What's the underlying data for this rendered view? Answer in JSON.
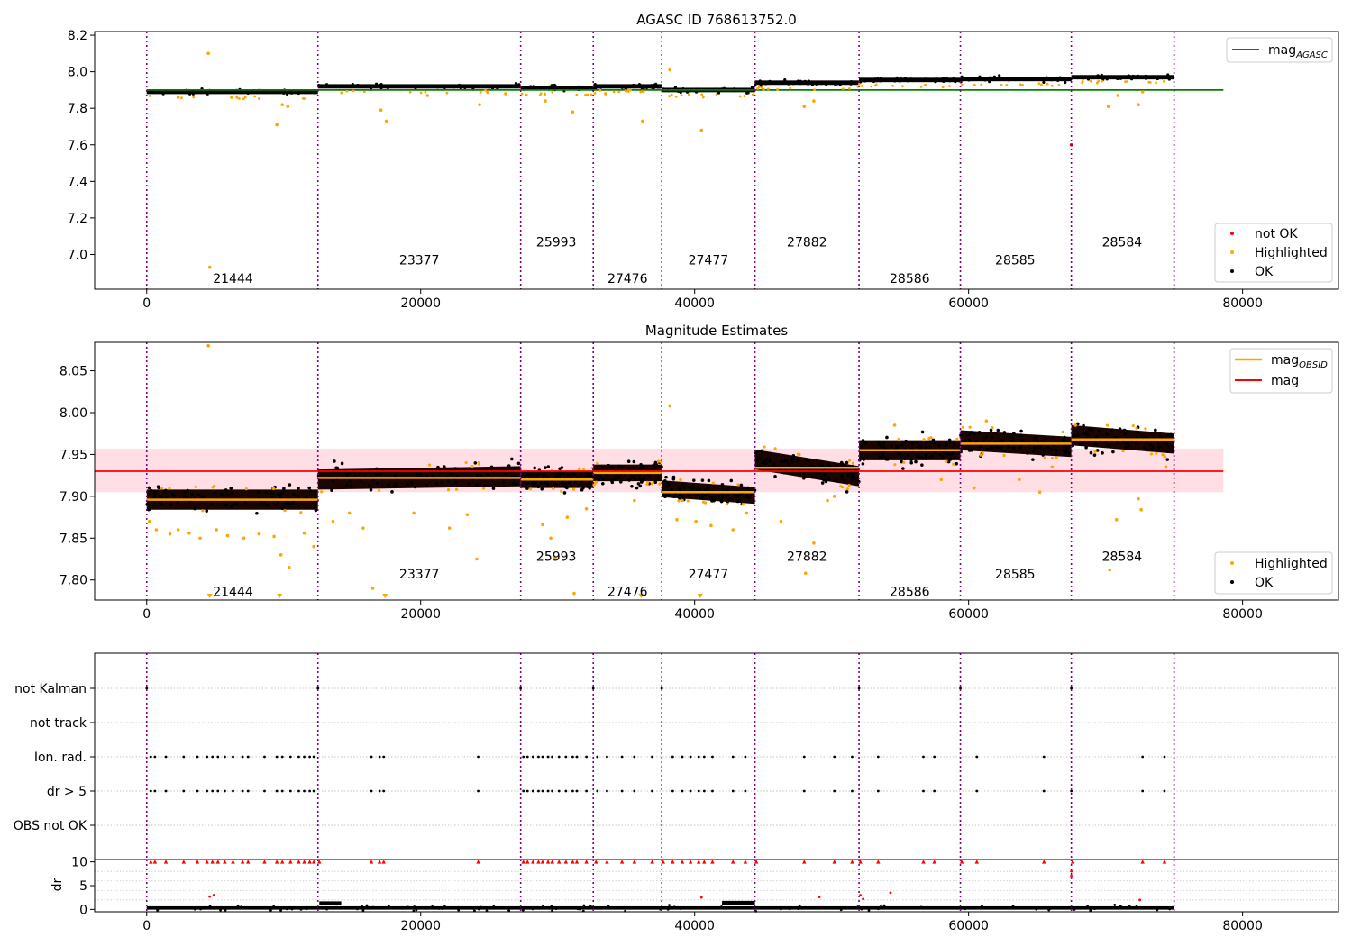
{
  "chart_data": [
    {
      "type": "scatter",
      "title": "AGASC ID 768613752.0",
      "xlabel": "",
      "ylabel": "",
      "xlim": [
        -3800,
        87000
      ],
      "ylim": [
        6.81,
        8.22
      ],
      "x_ticks": [
        "0",
        "20000",
        "40000",
        "60000",
        "80000"
      ],
      "y_ticks": [
        "7.0",
        "7.2",
        "7.4",
        "7.6",
        "7.8",
        "8.0",
        "8.2"
      ],
      "obsid_boundaries": [
        0,
        12500,
        27300,
        32600,
        37600,
        44400,
        52000,
        59400,
        67500,
        75000
      ],
      "segments": [
        {
          "obsid": "21444",
          "start": 0,
          "end": 12500,
          "mag": 7.89,
          "spread": 0.012
        },
        {
          "obsid": "23377",
          "start": 12500,
          "end": 27300,
          "mag": 7.92,
          "spread": 0.012
        },
        {
          "obsid": "25993",
          "start": 27300,
          "end": 32600,
          "mag": 7.91,
          "spread": 0.012
        },
        {
          "obsid": "27476",
          "start": 32600,
          "end": 37600,
          "mag": 7.92,
          "spread": 0.012
        },
        {
          "obsid": "27477",
          "start": 37600,
          "end": 44400,
          "mag": 7.9,
          "spread": 0.012
        },
        {
          "obsid": "27882",
          "start": 44400,
          "end": 52000,
          "mag": 7.94,
          "spread": 0.012
        },
        {
          "obsid": "28586",
          "start": 52000,
          "end": 59400,
          "mag": 7.955,
          "spread": 0.012
        },
        {
          "obsid": "28585",
          "start": 59400,
          "end": 67500,
          "mag": 7.96,
          "spread": 0.012
        },
        {
          "obsid": "28584",
          "start": 67500,
          "end": 75000,
          "mag": 7.97,
          "spread": 0.012
        }
      ],
      "obsid_labels": [
        {
          "text": "21444",
          "x": 6300,
          "y": 6.87
        },
        {
          "text": "23377",
          "x": 19900,
          "y": 6.97
        },
        {
          "text": "25993",
          "x": 29900,
          "y": 7.07
        },
        {
          "text": "27476",
          "x": 35100,
          "y": 6.87
        },
        {
          "text": "27477",
          "x": 41000,
          "y": 6.97
        },
        {
          "text": "27882",
          "x": 48200,
          "y": 7.07
        },
        {
          "text": "28586",
          "x": 55700,
          "y": 6.87
        },
        {
          "text": "28585",
          "x": 63400,
          "y": 6.97
        },
        {
          "text": "28584",
          "x": 71200,
          "y": 7.07
        }
      ],
      "agasc_mag": 7.9,
      "agasc_line_range": [
        0,
        78600
      ],
      "series": [
        {
          "name": "not OK",
          "color": "#ff0000",
          "points": [
            [
              67500,
              7.6
            ]
          ]
        },
        {
          "name": "Highlighted",
          "color": "#ffa500",
          "points": [
            [
              4500,
              8.1
            ],
            [
              4600,
              6.93
            ],
            [
              9500,
              7.71
            ],
            [
              9900,
              7.82
            ],
            [
              10300,
              7.81
            ],
            [
              17100,
              7.79
            ],
            [
              17500,
              7.73
            ],
            [
              24300,
              7.82
            ],
            [
              29100,
              7.84
            ],
            [
              31100,
              7.78
            ],
            [
              36200,
              7.73
            ],
            [
              38200,
              8.01
            ],
            [
              40500,
              7.68
            ],
            [
              48000,
              7.81
            ],
            [
              48700,
              7.84
            ],
            [
              70200,
              7.81
            ],
            [
              70900,
              7.87
            ],
            [
              72400,
              7.82
            ],
            [
              72700,
              7.89
            ],
            [
              2300,
              7.86
            ],
            [
              6200,
              7.86
            ],
            [
              20500,
              7.87
            ],
            [
              26200,
              7.88
            ],
            [
              33500,
              7.88
            ]
          ]
        },
        {
          "name": "OK",
          "color": "#000000"
        }
      ],
      "legend": {
        "placement": "lower-right",
        "entries": [
          "not OK",
          "Highlighted",
          "OK"
        ]
      },
      "legend2": {
        "placement": "top-right",
        "label": "mag",
        "sub": "AGASC",
        "color": "#008000"
      }
    },
    {
      "type": "scatter",
      "title": "Magnitude Estimates",
      "xlabel": "",
      "ylabel": "",
      "xlim": [
        -3800,
        87000
      ],
      "ylim": [
        7.776,
        8.084
      ],
      "x_ticks": [
        "0",
        "20000",
        "40000",
        "60000",
        "80000"
      ],
      "y_ticks": [
        "7.80",
        "7.85",
        "7.90",
        "7.95",
        "8.00",
        "8.05"
      ],
      "segments": [
        {
          "obsid": "21444",
          "start": 0,
          "end": 12500,
          "mag_obsid": 7.896,
          "slope": 0.0,
          "spread": 0.012
        },
        {
          "obsid": "23377",
          "start": 12500,
          "end": 27300,
          "mag_obsid": 7.922,
          "slope": 0.004,
          "spread": 0.012
        },
        {
          "obsid": "25993",
          "start": 27300,
          "end": 32600,
          "mag_obsid": 7.92,
          "slope": 0.0,
          "spread": 0.01
        },
        {
          "obsid": "27476",
          "start": 32600,
          "end": 37600,
          "mag_obsid": 7.928,
          "slope": 0.0,
          "spread": 0.01
        },
        {
          "obsid": "27477",
          "start": 37600,
          "end": 44400,
          "mag_obsid": 7.905,
          "slope": -0.008,
          "spread": 0.01
        },
        {
          "obsid": "27882",
          "start": 44400,
          "end": 52000,
          "mag_obsid": 7.934,
          "slope": -0.02,
          "spread": 0.012
        },
        {
          "obsid": "28586",
          "start": 52000,
          "end": 59400,
          "mag_obsid": 7.955,
          "slope": 0.0,
          "spread": 0.012
        },
        {
          "obsid": "28585",
          "start": 59400,
          "end": 67500,
          "mag_obsid": 7.963,
          "slope": -0.008,
          "spread": 0.012
        },
        {
          "obsid": "28584",
          "start": 67500,
          "end": 75000,
          "mag_obsid": 7.968,
          "slope": -0.01,
          "spread": 0.012
        }
      ],
      "obsid_labels": [
        {
          "text": "21444",
          "x": 6300,
          "y": 7.786
        },
        {
          "text": "23377",
          "x": 19900,
          "y": 7.807
        },
        {
          "text": "25993",
          "x": 29900,
          "y": 7.828
        },
        {
          "text": "27476",
          "x": 35100,
          "y": 7.786
        },
        {
          "text": "27477",
          "x": 41000,
          "y": 7.807
        },
        {
          "text": "27882",
          "x": 48200,
          "y": 7.828
        },
        {
          "text": "28586",
          "x": 55700,
          "y": 7.786
        },
        {
          "text": "28585",
          "x": 63400,
          "y": 7.807
        },
        {
          "text": "28584",
          "x": 71200,
          "y": 7.828
        }
      ],
      "mag": 7.93,
      "mag_band": [
        7.905,
        7.957
      ],
      "mag_line_range": [
        -3800,
        78600
      ],
      "series": [
        {
          "name": "Highlighted",
          "color": "#ffa500",
          "points": [
            [
              4500,
              8.08
            ],
            [
              38200,
              8.008
            ],
            [
              200,
              7.87
            ],
            [
              700,
              7.86
            ],
            [
              1700,
              7.855
            ],
            [
              2300,
              7.86
            ],
            [
              3100,
              7.856
            ],
            [
              3900,
              7.85
            ],
            [
              5100,
              7.86
            ],
            [
              5900,
              7.853
            ],
            [
              7100,
              7.85
            ],
            [
              8200,
              7.855
            ],
            [
              9300,
              7.852
            ],
            [
              9800,
              7.83
            ],
            [
              10400,
              7.815
            ],
            [
              11500,
              7.856
            ],
            [
              12200,
              7.84
            ],
            [
              13600,
              7.87
            ],
            [
              14800,
              7.88
            ],
            [
              15800,
              7.862
            ],
            [
              16500,
              7.79
            ],
            [
              19500,
              7.88
            ],
            [
              22100,
              7.862
            ],
            [
              23400,
              7.878
            ],
            [
              24100,
              7.825
            ],
            [
              28900,
              7.866
            ],
            [
              29500,
              7.85
            ],
            [
              29800,
              7.826
            ],
            [
              30700,
              7.875
            ],
            [
              31200,
              7.784
            ],
            [
              32100,
              7.885
            ],
            [
              35600,
              7.895
            ],
            [
              38700,
              7.872
            ],
            [
              40100,
              7.87
            ],
            [
              41200,
              7.865
            ],
            [
              42800,
              7.86
            ],
            [
              43800,
              7.88
            ],
            [
              46300,
              7.87
            ],
            [
              48100,
              7.808
            ],
            [
              48700,
              7.844
            ],
            [
              49700,
              7.895
            ],
            [
              50200,
              7.9
            ],
            [
              54600,
              7.985
            ],
            [
              58000,
              7.92
            ],
            [
              60400,
              7.91
            ],
            [
              61300,
              7.99
            ],
            [
              63700,
              7.92
            ],
            [
              65200,
              7.905
            ],
            [
              66100,
              7.935
            ],
            [
              70300,
              7.812
            ],
            [
              70800,
              7.872
            ],
            [
              72600,
              7.884
            ],
            [
              72400,
              7.897
            ],
            [
              67800,
              7.985
            ],
            [
              74400,
              7.935
            ]
          ]
        },
        {
          "name": "OK",
          "color": "#000000"
        }
      ],
      "markers_bottom": [
        4600,
        9700,
        17400,
        36100,
        40400
      ],
      "legend": {
        "placement": "lower-right",
        "entries": [
          "Highlighted",
          "OK"
        ]
      },
      "legend2": {
        "placement": "top-right",
        "entries": [
          {
            "label": "mag",
            "sub": "OBSID",
            "color": "#ffa500"
          },
          {
            "label": "mag",
            "sub": "",
            "color": "#ff0000"
          }
        ]
      }
    },
    {
      "type": "scatter",
      "title": "",
      "xlabel": "",
      "ylabel": "",
      "xlim": [
        -3800,
        87000
      ],
      "y_categories": [
        "not Kalman",
        "not track",
        "Ion. rad.",
        "dr > 5",
        "OBS not OK"
      ],
      "flag_points": {
        "not Kalman": [
          0,
          12500,
          27300,
          32600,
          37600,
          52000,
          59400,
          67500
        ],
        "not track": [],
        "Ion. rad.": [
          300,
          600,
          1400,
          2700,
          3700,
          4400,
          4800,
          5200,
          5700,
          6300,
          7000,
          7400,
          8600,
          9500,
          9900,
          10500,
          11100,
          11500,
          11900,
          12200,
          16400,
          17000,
          17300,
          24200,
          27500,
          27800,
          28200,
          28600,
          28900,
          29300,
          29600,
          30100,
          30600,
          31100,
          31400,
          32100,
          32900,
          33600,
          34700,
          35600,
          36900,
          38400,
          39100,
          39700,
          40300,
          40700,
          41300,
          42800,
          43700,
          48000,
          50200,
          51500,
          53400,
          56700,
          57500,
          60600,
          65500,
          72700,
          74300
        ],
        "dr > 5": [
          300,
          600,
          1400,
          2700,
          3700,
          4400,
          4800,
          5200,
          5700,
          6300,
          7000,
          7400,
          8600,
          9500,
          9900,
          10500,
          11100,
          11500,
          11900,
          12200,
          16400,
          17000,
          17300,
          24200,
          27500,
          27800,
          28200,
          28600,
          28900,
          29300,
          29600,
          30100,
          30600,
          31100,
          31400,
          32100,
          32900,
          33600,
          34700,
          35600,
          36900,
          38400,
          39100,
          39700,
          40300,
          40700,
          41300,
          42800,
          43700,
          48000,
          50200,
          51500,
          53400,
          56700,
          57500,
          60600,
          65500,
          67500,
          72700,
          74300
        ],
        "OBS not OK": []
      }
    },
    {
      "type": "scatter",
      "title": "",
      "xlabel": "",
      "ylabel": "dr",
      "xlim": [
        -3800,
        87000
      ],
      "ylim": [
        -0.5,
        10.5
      ],
      "x_ticks": [
        "0",
        "20000",
        "40000",
        "60000",
        "80000"
      ],
      "y_ticks": [
        "0",
        "5",
        "10"
      ],
      "dr_baseline": 0.3,
      "dr_high_segments": [
        {
          "start": 12600,
          "end": 14200,
          "value": 1.3
        },
        {
          "start": 42000,
          "end": 44400,
          "value": 1.4
        }
      ],
      "red_points_at_10": [
        300,
        600,
        1400,
        2700,
        3700,
        4400,
        4800,
        5200,
        5700,
        6300,
        7000,
        7400,
        8600,
        9500,
        9900,
        10500,
        11100,
        11500,
        11900,
        12200,
        12600,
        16400,
        17000,
        17300,
        24200,
        27500,
        27800,
        28200,
        28600,
        28900,
        29300,
        29600,
        30100,
        30600,
        31100,
        31400,
        32100,
        32800,
        33600,
        34700,
        35600,
        36900,
        37700,
        38400,
        39100,
        39700,
        40300,
        40700,
        41300,
        42800,
        43700,
        44500,
        48000,
        50200,
        51500,
        52100,
        53400,
        56700,
        57500,
        59500,
        60600,
        65500,
        67600,
        72700,
        74300
      ],
      "extra_points": [
        [
          4600,
          2.7
        ],
        [
          4900,
          3.0
        ],
        [
          40500,
          2.5
        ],
        [
          49100,
          2.6
        ],
        [
          52100,
          3.0
        ],
        [
          52300,
          2.2
        ],
        [
          54300,
          3.5
        ],
        [
          67500,
          8.0
        ],
        [
          67500,
          7.0
        ],
        [
          72500,
          2.0
        ]
      ]
    }
  ]
}
